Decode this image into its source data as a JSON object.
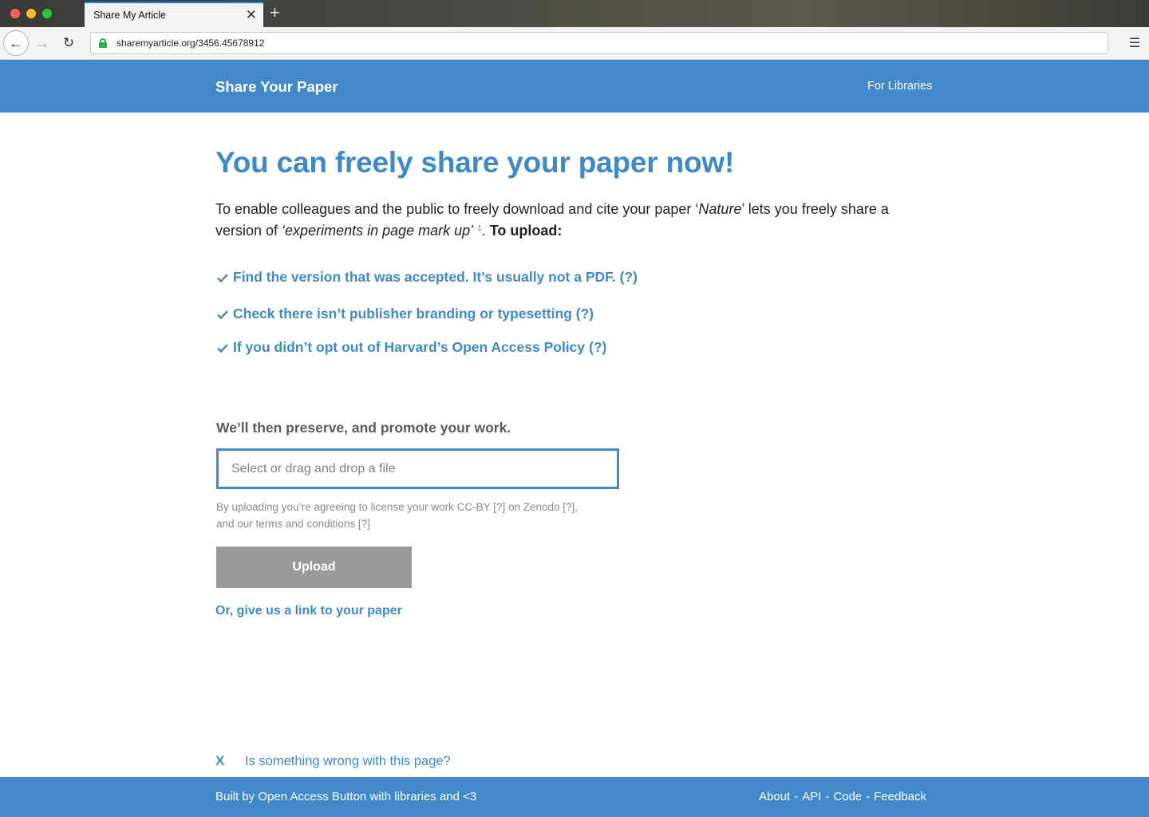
{
  "browser": {
    "tab_title": "Share My Article",
    "tab_close": "✕",
    "new_tab": "+",
    "url": "sharemyarticle.org/3456.45678912",
    "back": "←",
    "forward": "→",
    "reload": "↻",
    "menu": "☰"
  },
  "header": {
    "brand": "Share Your Paper",
    "nav_link": "For Libraries"
  },
  "main": {
    "headline": "You can freely share your paper now!",
    "intro": {
      "part1": "To enable colleagues and the public to freely download and cite your paper ‘",
      "journal": "Nature",
      "part2": "’ lets you freely share a version of ",
      "title": "‘experiments in page mark up’",
      "footnote": "1",
      "part3": ".  ",
      "to_upload": "To upload:"
    },
    "checklist": [
      "Find the version that was accepted. It’s usually not a PDF. (?)",
      "Check there isn’t publisher branding or typesetting (?)",
      "If you didn’t opt out of Harvard’s Open Access Policy (?)"
    ],
    "preserve_text": "We’ll then preserve, and promote your work.",
    "file_placeholder": "Select or drag and drop a file",
    "agree_line1": "By uploading you’re agreeing to license your work CC-BY [?] on Zenodo [?],",
    "agree_line2": "and our terms and conditions [?]",
    "upload_label": "Upload",
    "link_label": "Or, give us a link to your paper"
  },
  "feedback": {
    "close": "X",
    "text": "Is something wrong with this page?"
  },
  "footer": {
    "credit": "Built by Open Access Button with libraries and <3",
    "links": [
      "About",
      "API",
      "Code",
      "Feedback"
    ],
    "separator": "-"
  },
  "colors": {
    "brand_blue": "#4189c9",
    "link_blue": "#3f8ac6",
    "upload_button": "#999999",
    "lock_green": "#2bb24c"
  }
}
